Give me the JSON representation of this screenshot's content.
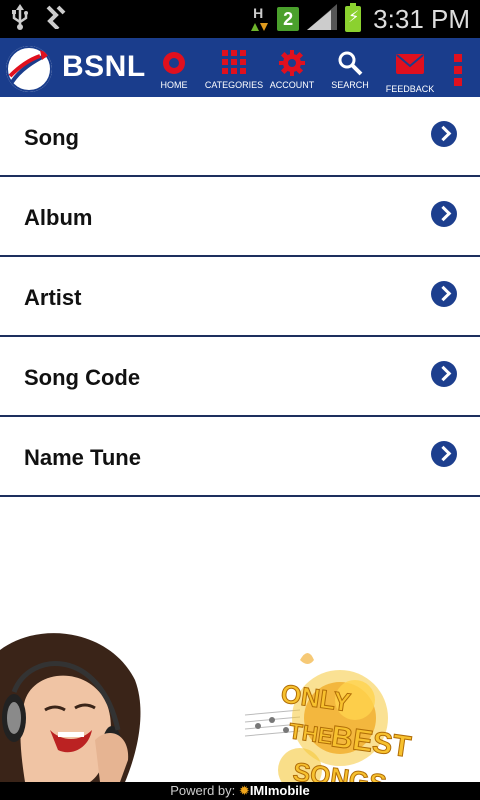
{
  "status_bar": {
    "time": "3:31 PM",
    "sim_slot": "2",
    "network_type": "H",
    "left_icons": [
      "usb-icon",
      "debug-icon"
    ]
  },
  "header": {
    "brand": "BSNL",
    "nav": [
      {
        "label": "HOME",
        "icon": "home-icon"
      },
      {
        "label": "CATEGORIES",
        "icon": "grid-icon"
      },
      {
        "label": "ACCOUNT",
        "icon": "gear-icon"
      },
      {
        "label": "SEARCH",
        "icon": "search-icon"
      },
      {
        "label": "FEEDBACK",
        "icon": "mail-icon"
      },
      {
        "label": "",
        "icon": "more-icon"
      }
    ]
  },
  "list": {
    "items": [
      {
        "label": "Song"
      },
      {
        "label": "Album"
      },
      {
        "label": "Artist"
      },
      {
        "label": "Song Code"
      },
      {
        "label": "Name Tune"
      }
    ]
  },
  "banner": {
    "slogan_lines": [
      "ONLY",
      "THE",
      "BEST",
      "SONGS"
    ]
  },
  "footer": {
    "powered_prefix": "Powerd by:",
    "brand": "IMImobile"
  },
  "colors": {
    "header_bg": "#1a3d8c",
    "accent_red": "#e0101e",
    "row_divider": "#1d2f5e",
    "arrow_bg": "#1d3f8e"
  }
}
